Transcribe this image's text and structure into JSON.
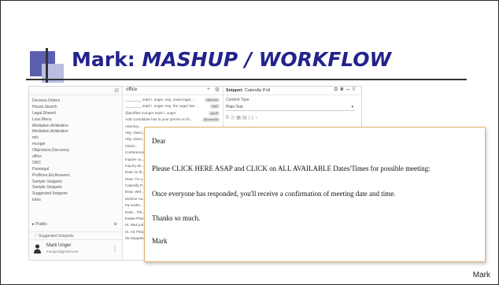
{
  "slide": {
    "title_plain": "Mark:",
    "title_em": "MASHUP / WORKFLOW",
    "footer_name": "Mark"
  },
  "sidebar": {
    "items": [
      "Decrees.Orders",
      "House.Search",
      "Legal.Shared",
      "Loss.Menu",
      "Mediation.Arbitration",
      "Mediation.Arbitration",
      "mls",
      "munger",
      "Objections.Discovery",
      "office",
      "ORC",
      "Paralegal",
      "ProBono.Ed.Answers",
      "Sample Snippets",
      "Sample Snippets",
      "Suggested Snippets",
      "tutes"
    ],
    "public_label": "Public",
    "suggested_label": "Suggested Snippets",
    "user_name": "Mark Unger",
    "user_email": "munger@gmail.com"
  },
  "middle": {
    "folder_name": "office",
    "snippets": [
      {
        "text": "________ mark i. unger, esq. muse legal ...",
        "tag": "sigmuse"
      },
      {
        "text": "________ mark i. unger, esq. the unger law ...",
        "tag": "sigul"
      },
      {
        "text": "@profiles munger mark i. unger",
        "tag": "plpuff"
      },
      {
        "text": "Add ccandidate has to your iphone so th...",
        "tag": "@ccandid"
      },
      {
        "text": "Attorney...",
        "tag": ""
      },
      {
        "text": "Atty. client...",
        "tag": ""
      },
      {
        "text": "Atty. client...",
        "tag": ""
      },
      {
        "text": "Client...",
        "tag": ""
      },
      {
        "text": "Conference...",
        "tag": ""
      },
      {
        "text": "Inquire ca...",
        "tag": ""
      },
      {
        "text": "Inquiry de...",
        "tag": ""
      },
      {
        "text": "Dear As th...",
        "tag": ""
      },
      {
        "text": "Dear. I'm u...",
        "tag": ""
      },
      {
        "text": "Calendly P...",
        "tag": ""
      },
      {
        "text": "Dear. Wel...",
        "tag": ""
      },
      {
        "text": "Decline Ca...",
        "tag": ""
      },
      {
        "text": "Irq worke...",
        "tag": ""
      },
      {
        "text": "Dear... Ple...",
        "tag": ""
      },
      {
        "text": "Estate Plan...",
        "tag": ""
      },
      {
        "text": "Hi. Was jus...",
        "tag": ""
      },
      {
        "text": "Hi. All, Plea...",
        "tag": ""
      },
      {
        "text": "35 snippets",
        "tag": ""
      }
    ]
  },
  "editor": {
    "snippet_label": "Snippet:",
    "snippet_title": "Calendly Poll",
    "content_type_label": "Content Type",
    "content_type_value": "Plain Text"
  },
  "popup": {
    "greeting": "Dear",
    "line1": "Please CLICK HERE ASAP and CLICK on ALL AVAILABLE Dates/Times for possible meeting:",
    "line2": "Once everyone has responded, you'll receive a confirmation of meeting date and time.",
    "line3": "Thanks so much.",
    "signature": "Mark"
  },
  "colors": {
    "title": "#23238c",
    "deco_dark": "#5a5fb0",
    "deco_light": "#b9bde0",
    "popup_border": "#e0b070"
  }
}
